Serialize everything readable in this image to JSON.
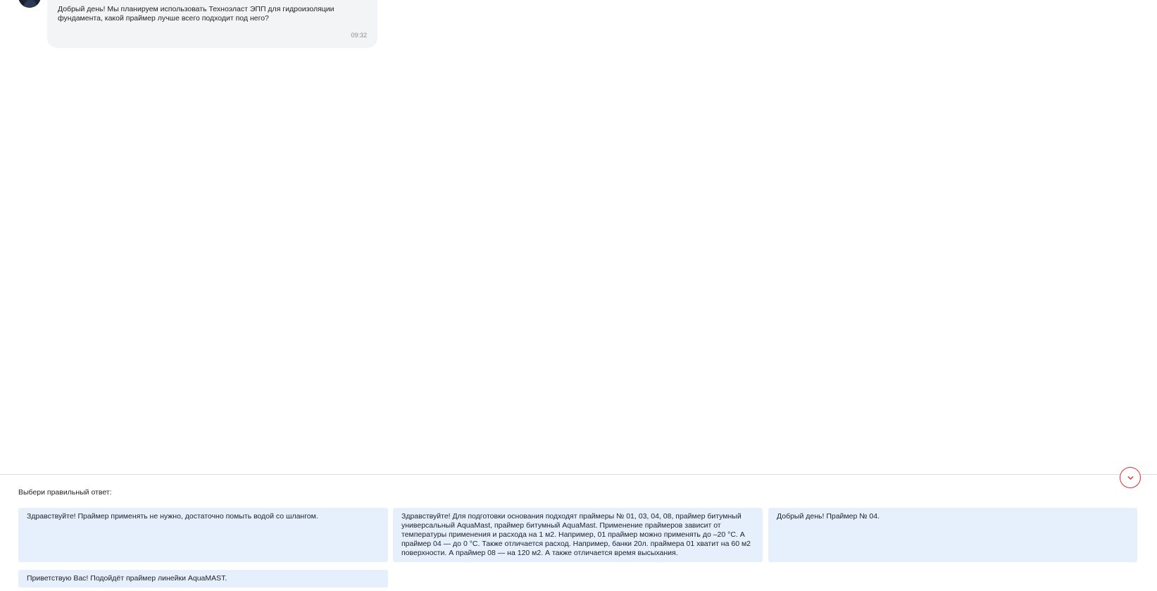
{
  "chat": {
    "message": {
      "text": "Добрый день! Мы планируем использовать Техноэласт ЭПП для гидроизоляции фундамента, какой праймер лучше всего подходит под него?",
      "time": "09:32"
    }
  },
  "answers": {
    "prompt": "Выбери правильный ответ:",
    "options": [
      {
        "text": "Здравствуйте! Праймер применять не нужно, достаточно помыть водой со шлангом."
      },
      {
        "text": "Здравствуйте! Для подготовки основания подходят праймеры № 01, 03, 04, 08, праймер битумный универсальный AquaMast, праймер битумный AquaMast. Применение праймеров зависит от температуры применения и расхода на 1 м2. Например, 01 праймер можно применять до –20 °С. А праймер 04 — до 0 °С. Также отличается расход. Например, банки 20л. праймера 01 хватит на 60 м2 поверхности. А праймер 08 — на 120 м2. А также отличается время высыхания."
      },
      {
        "text": "Добрый день! Праймер № 04."
      },
      {
        "text": "Приветствую Вас! Подойдёт праймер линейки AquaMAST."
      }
    ]
  },
  "icons": {
    "scroll_down": "chevron-down-icon",
    "avatar": "user-avatar"
  },
  "colors": {
    "accent": "#d9312b",
    "bubble_bg": "#f3f4f6",
    "option_bg": "#e5f0fc"
  }
}
